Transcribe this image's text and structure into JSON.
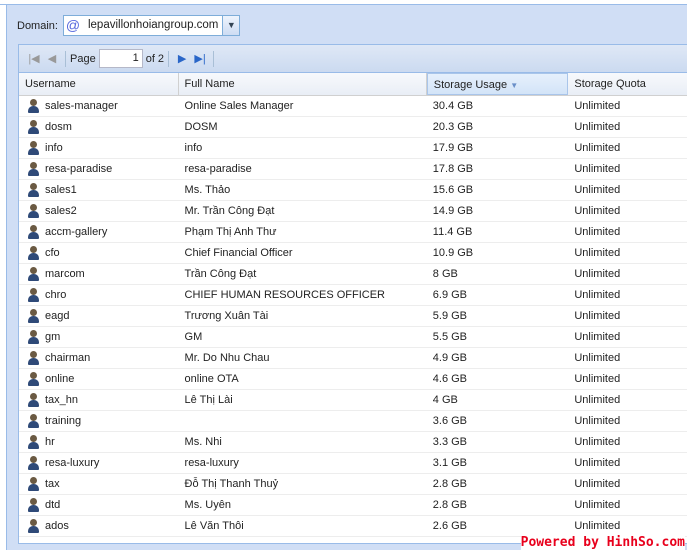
{
  "domain": {
    "label": "Domain:",
    "value": "lepavillonhoiangroup.com",
    "icon": "at-icon"
  },
  "pager": {
    "page_label": "Page",
    "page_value": "1",
    "of_label": "of 2"
  },
  "columns": [
    "Username",
    "Full Name",
    "Storage Usage",
    "Storage Quota"
  ],
  "sorted_column": "Storage Usage",
  "rows": [
    [
      "sales-manager",
      "Online Sales Manager",
      "30.4 GB",
      "Unlimited"
    ],
    [
      "dosm",
      "DOSM",
      "20.3 GB",
      "Unlimited"
    ],
    [
      "info",
      "info",
      "17.9 GB",
      "Unlimited"
    ],
    [
      "resa-paradise",
      "resa-paradise",
      "17.8 GB",
      "Unlimited"
    ],
    [
      "sales1",
      "Ms. Thảo",
      "15.6 GB",
      "Unlimited"
    ],
    [
      "sales2",
      "Mr. Trần Công Đạt",
      "14.9 GB",
      "Unlimited"
    ],
    [
      "accm-gallery",
      "Phạm Thị Anh Thư",
      "11.4 GB",
      "Unlimited"
    ],
    [
      "cfo",
      "Chief Financial Officer",
      "10.9 GB",
      "Unlimited"
    ],
    [
      "marcom",
      "Trần Công Đạt",
      "8 GB",
      "Unlimited"
    ],
    [
      "chro",
      "CHIEF HUMAN RESOURCES OFFICER",
      "6.9 GB",
      "Unlimited"
    ],
    [
      "eagd",
      "Trương Xuân Tài",
      "5.9 GB",
      "Unlimited"
    ],
    [
      "gm",
      "GM",
      "5.5 GB",
      "Unlimited"
    ],
    [
      "chairman",
      "Mr. Do Nhu Chau",
      "4.9 GB",
      "Unlimited"
    ],
    [
      "online",
      "online OTA",
      "4.6 GB",
      "Unlimited"
    ],
    [
      "tax_hn",
      "Lê Thị Lài",
      "4 GB",
      "Unlimited"
    ],
    [
      "training",
      "",
      "3.6 GB",
      "Unlimited"
    ],
    [
      "hr",
      "Ms. Nhi",
      "3.3 GB",
      "Unlimited"
    ],
    [
      "resa-luxury",
      "resa-luxury",
      "3.1 GB",
      "Unlimited"
    ],
    [
      "tax",
      "Đỗ Thị Thanh Thuỷ",
      "2.8 GB",
      "Unlimited"
    ],
    [
      "dtd",
      "Ms. Uyên",
      "2.8 GB",
      "Unlimited"
    ],
    [
      "ados",
      "Lê Văn Thôi",
      "2.6 GB",
      "Unlimited"
    ]
  ],
  "watermark": "Powered by HinhSo.com"
}
